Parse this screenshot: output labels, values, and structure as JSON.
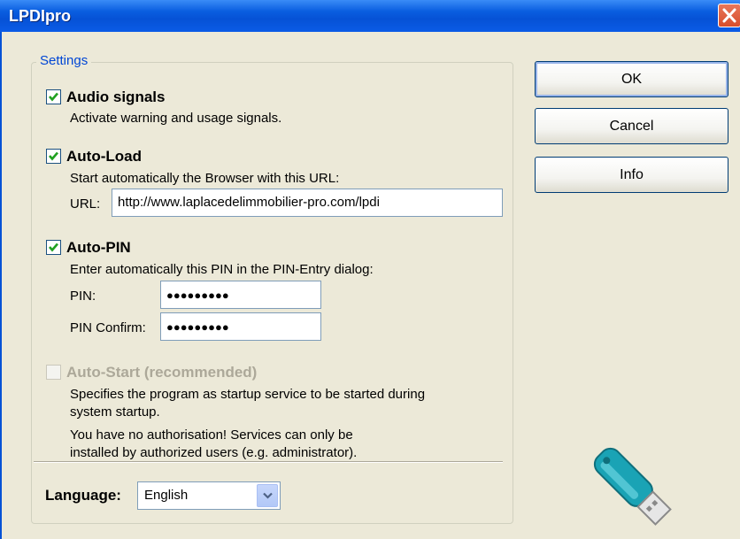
{
  "window": {
    "title": "LPDIpro"
  },
  "settings": {
    "group_title": "Settings",
    "audio": {
      "label": "Audio signals",
      "checked": true,
      "description": "Activate warning and usage signals."
    },
    "autoload": {
      "label": "Auto-Load",
      "checked": true,
      "description": "Start automatically the Browser with this URL:",
      "url_label": "URL:",
      "url_value": "http://www.laplacedelimmobilier-pro.com/lpdi"
    },
    "autopin": {
      "label": "Auto-PIN",
      "checked": true,
      "description": "Enter automatically this PIN in the PIN-Entry dialog:",
      "pin_label": "PIN:",
      "pin_value": "●●●●●●●●●",
      "pin_confirm_label": "PIN Confirm:",
      "pin_confirm_value": "●●●●●●●●●"
    },
    "autostart": {
      "label": "Auto-Start (recommended)",
      "checked": false,
      "disabled": true,
      "description_line1": "Specifies the program as startup service to be started during",
      "description_line2": "system startup.",
      "warning_line1": "You have no authorisation! Services can only be",
      "warning_line2": "installed by authorized users (e.g. administrator)."
    },
    "language": {
      "label": "Language:",
      "selected": "English"
    }
  },
  "buttons": {
    "ok": "OK",
    "cancel": "Cancel",
    "info": "Info"
  },
  "icons": {
    "close": "close-icon",
    "checkmark": "checkmark-icon",
    "dropdown": "chevron-down-icon",
    "usb": "usb-key-icon"
  },
  "colors": {
    "title_bar": "#0a5ee0",
    "group_title": "#0046d5",
    "close_button": "#d84e2c",
    "usb_key": "#1aa3b5"
  }
}
